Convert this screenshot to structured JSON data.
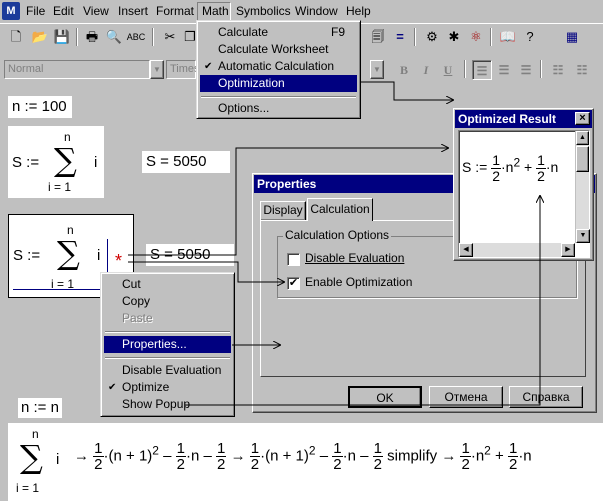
{
  "app": {
    "logo": "M"
  },
  "menubar": {
    "items": [
      "File",
      "Edit",
      "View",
      "Insert",
      "Format",
      "Math",
      "Symbolics",
      "Window",
      "Help"
    ]
  },
  "format_toolbar": {
    "style": "Normal",
    "font": "Times",
    "bold": "B",
    "italic": "I",
    "underline": "U"
  },
  "worksheet": {
    "n_def": "n := 100",
    "sum1": {
      "lhs": "S :=",
      "top": "n",
      "bottom": "i = 1",
      "body": "i"
    },
    "result1": "S = 5050",
    "sum2": {
      "lhs": "S :=",
      "top": "n",
      "bottom": "i = 1",
      "body": "i"
    },
    "result2": "S = 5050",
    "marker": "*",
    "n_eq": "n := n",
    "bottom_expr": {
      "top": "n",
      "bottom": "i = 1",
      "body": "i",
      "arrow": "→",
      "one": "1",
      "two": "2",
      "plus1": "(n + 1)",
      "sq": "2",
      "minus": "–",
      "plus": "+",
      "dot_n": "·n",
      "dot": "·",
      "simplify": "simplify"
    }
  },
  "math_menu": {
    "items": [
      {
        "label": "Calculate",
        "shortcut": "F9"
      },
      {
        "label": "Calculate Worksheet"
      },
      {
        "label": "Automatic Calculation",
        "checked": "✔"
      },
      {
        "label": "Optimization"
      },
      {
        "label": "Options..."
      }
    ]
  },
  "context_menu": {
    "items": [
      {
        "label": "Cut"
      },
      {
        "label": "Copy"
      },
      {
        "label": "Paste"
      },
      {
        "label": "Properties..."
      },
      {
        "label": "Disable Evaluation"
      },
      {
        "label": "Optimize",
        "checked": "✔"
      },
      {
        "label": "Show Popup"
      }
    ]
  },
  "properties_dialog": {
    "title": "Properties",
    "tabs": [
      "Display",
      "Calculation"
    ],
    "group": "Calculation Options",
    "disable_eval": "Disable Evaluation",
    "enable_opt": "Enable Optimization",
    "enable_opt_check": "✔",
    "ok": "OK",
    "cancel": "Отмена",
    "help": "Справка"
  },
  "optimized_result": {
    "title": "Optimized Result",
    "close": "×",
    "lhs": "S :=",
    "one": "1",
    "two": "2",
    "dot_n2": "·n",
    "sq": "2",
    "plus": "+",
    "dot_n": "·n"
  }
}
